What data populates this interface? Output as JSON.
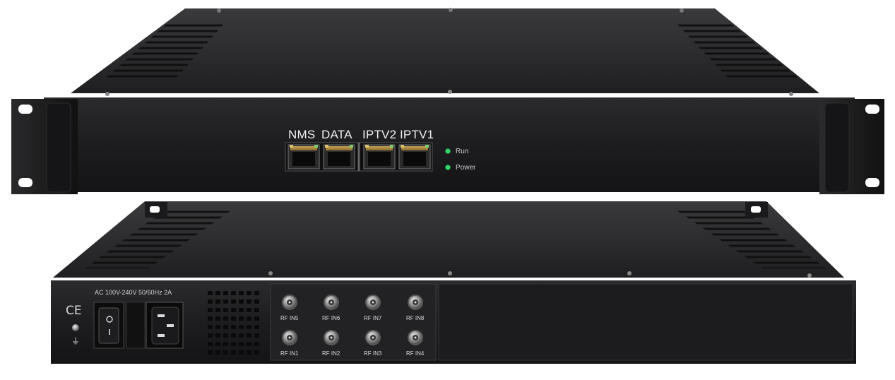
{
  "front_panel": {
    "ports": [
      {
        "label": "NMS"
      },
      {
        "label": "DATA"
      },
      {
        "label": "IPTV2"
      },
      {
        "label": "IPTV1"
      }
    ],
    "indicators": [
      {
        "label": "Run",
        "color": "#39d36b"
      },
      {
        "label": "Power",
        "color": "#39d36b"
      }
    ]
  },
  "rear_panel": {
    "power_rating": "AC 100V-240V 50/60Hz 2A",
    "cert_mark": "CE",
    "rf_inputs_top": [
      "RF IN5",
      "RF IN6",
      "RF IN7",
      "RF IN8"
    ],
    "rf_inputs_bottom": [
      "RF IN1",
      "RF IN2",
      "RF IN3",
      "RF IN4"
    ]
  }
}
